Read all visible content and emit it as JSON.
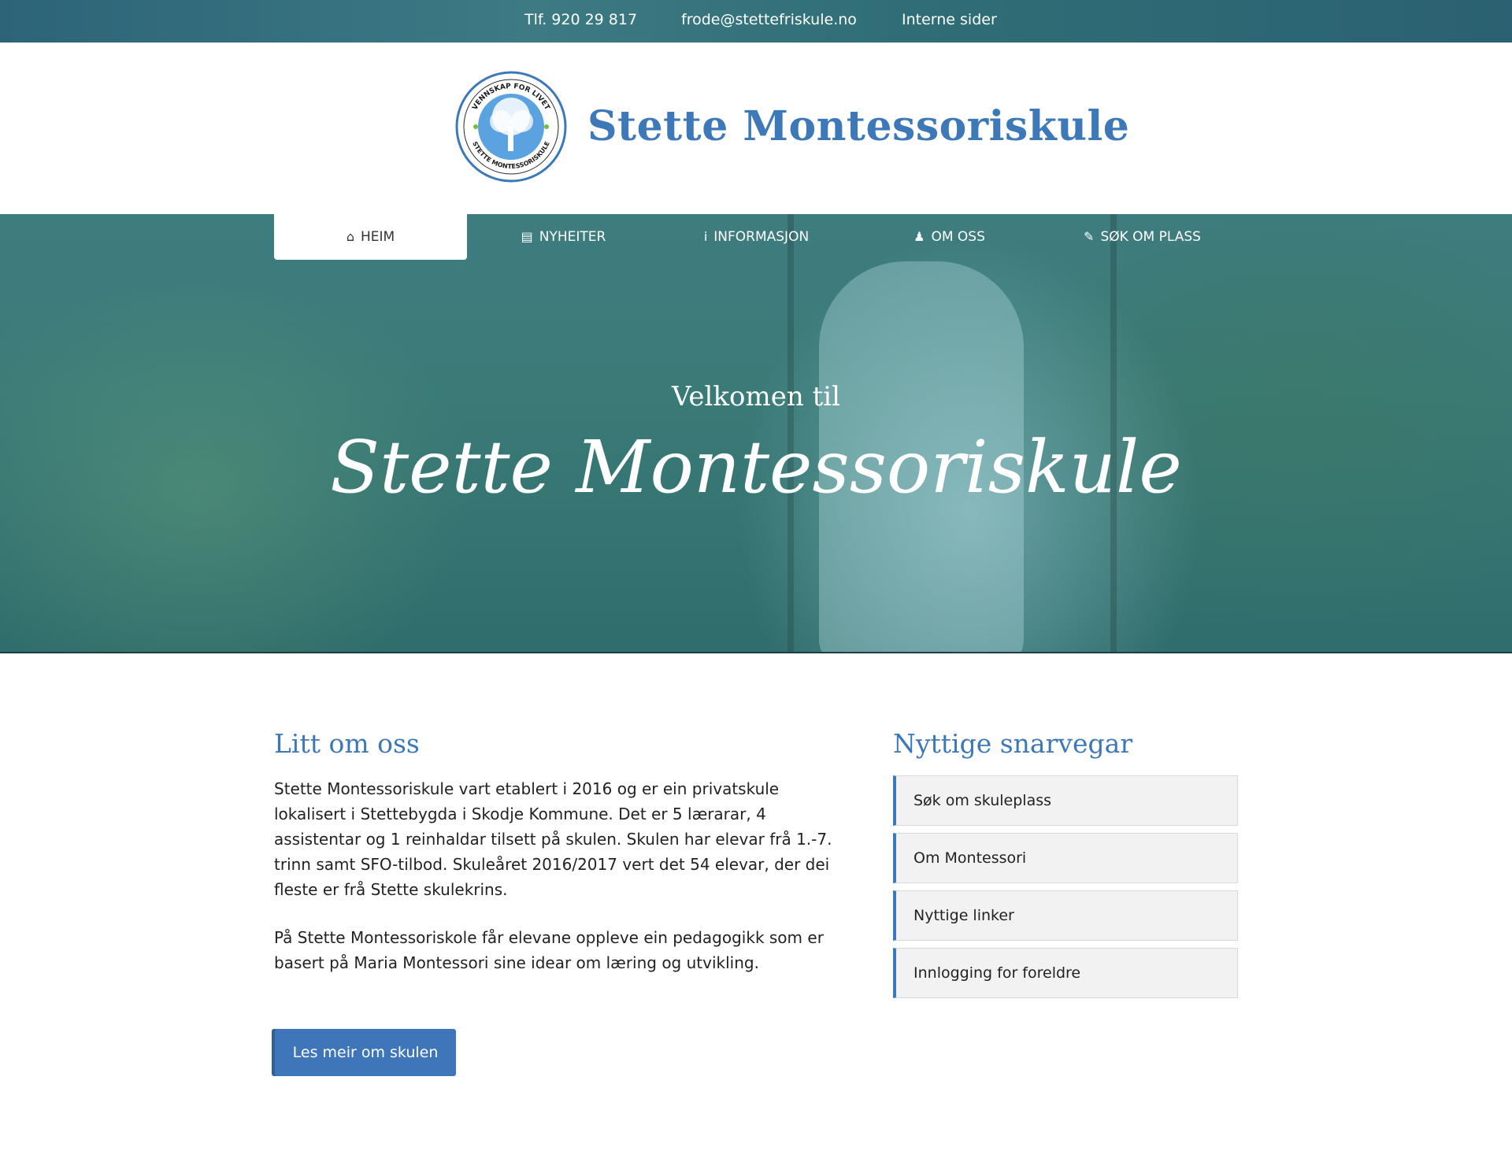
{
  "topbar": {
    "phone": "Tlf. 920 29 817",
    "email": "frode@stettefriskule.no",
    "internal": "Interne sider"
  },
  "header": {
    "title": "Stette Montessoriskule",
    "logo_text_top": "VENNSKAP FOR LIVET",
    "logo_text_bottom": "STETTE MONTESSORISKULE"
  },
  "nav": {
    "items": [
      {
        "label": "HEIM",
        "icon": "home-icon",
        "glyph": "⌂"
      },
      {
        "label": "NYHEITER",
        "icon": "newspaper-icon",
        "glyph": "▤"
      },
      {
        "label": "INFORMASJON",
        "icon": "info-icon",
        "glyph": "i"
      },
      {
        "label": "OM OSS",
        "icon": "user-icon",
        "glyph": "♟"
      },
      {
        "label": "SØK OM PLASS",
        "icon": "edit-icon",
        "glyph": "✎"
      }
    ]
  },
  "hero": {
    "subtitle": "Velkomen til",
    "title": "Stette Montessoriskule"
  },
  "about": {
    "heading": "Litt om oss",
    "p1": "Stette Montessoriskule vart etablert i 2016 og er ein privatskule lokalisert i Stettebygda i Skodje Kommune. Det er 5 lærarar, 4 assistentar og 1 reinhaldar tilsett på skulen. Skulen har elevar frå 1.-7. trinn samt SFO-tilbod. Skuleåret 2016/2017 vert det 54 elevar, der dei fleste er frå Stette skulekrins.",
    "p2": "På Stette Montessoriskole får elevane oppleve ein pedagogikk som er basert på Maria Montessori sine idear om læring og utvikling.",
    "button": "Les meir om skulen"
  },
  "shortcuts": {
    "heading": "Nyttige snarvegar",
    "items": [
      "Søk om skuleplass",
      "Om Montessori",
      "Nyttige linker",
      "Innlogging for foreldre"
    ]
  },
  "colors": {
    "accent": "#3d78b8",
    "hero": "#3a7b78"
  }
}
